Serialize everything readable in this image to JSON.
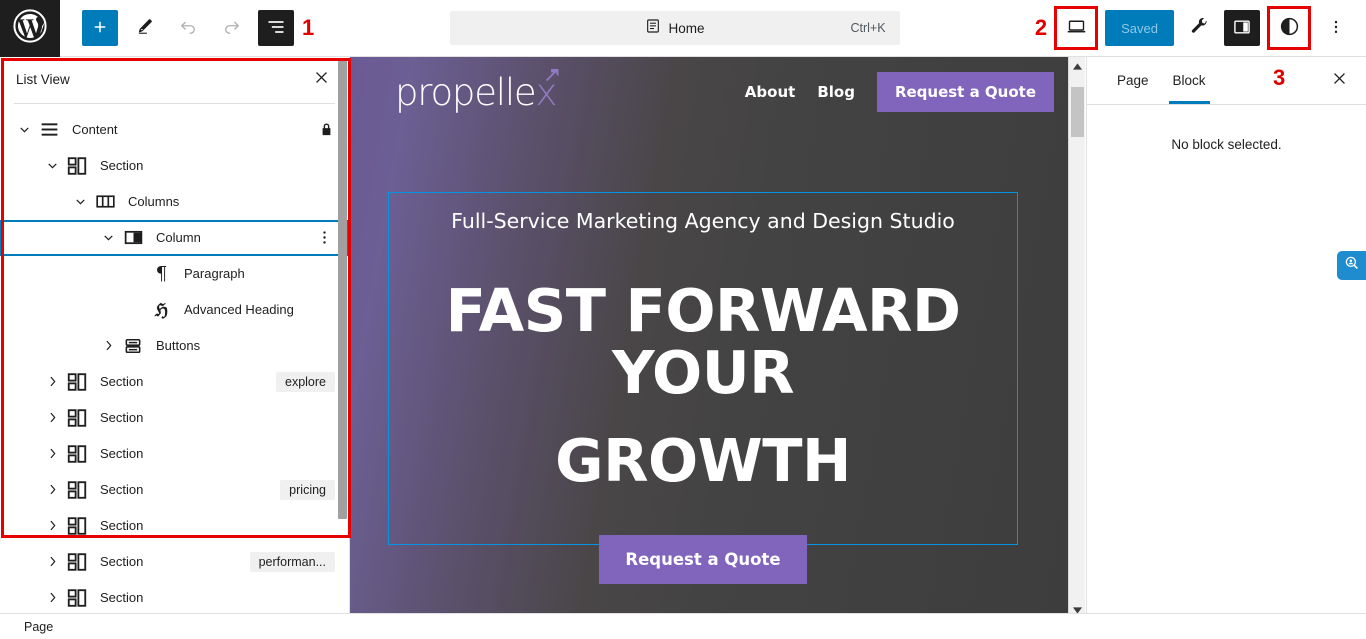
{
  "toolbar": {
    "wp_logo_icon": "wordpress-logo-icon",
    "add_block_label": "+",
    "add_block_icon": "plus-icon",
    "tools_icon": "pencil-icon",
    "undo_icon": "undo-arrow-icon",
    "redo_icon": "redo-arrow-icon",
    "list_view_icon": "list-view-icon",
    "marker_1": "1",
    "marker_2": "2",
    "marker_3": "3",
    "document": {
      "icon": "page-document-icon",
      "title": "Home",
      "shortcut": "Ctrl+K"
    },
    "view_device_icon": "laptop-view-icon",
    "save_label": "Saved",
    "tools_wrench_icon": "wrench-icon",
    "settings_sidebar_icon": "settings-sidebar-icon",
    "contrast_icon": "contrast-half-circle-icon",
    "options_icon": "three-dots-vertical-icon"
  },
  "list_view": {
    "title": "List View",
    "close_icon": "close-x-icon",
    "lock_icon": "lock-icon",
    "kebab_icon": "three-dots-vertical-icon",
    "rows": [
      {
        "label": "Content",
        "icon": "content-lines-icon",
        "depth": 0,
        "chevron": "down",
        "selected": false,
        "lock": true
      },
      {
        "label": "Section",
        "icon": "section-block-icon",
        "depth": 1,
        "chevron": "down",
        "selected": false
      },
      {
        "label": "Columns",
        "icon": "columns-icon",
        "depth": 2,
        "chevron": "down",
        "selected": false
      },
      {
        "label": "Column",
        "icon": "column-icon",
        "depth": 3,
        "chevron": "down",
        "selected": true,
        "kebab": true
      },
      {
        "label": "Paragraph",
        "icon": "paragraph-pilcrow-icon",
        "depth": 4,
        "chevron": "none",
        "selected": false
      },
      {
        "label": "Advanced Heading",
        "icon": "advanced-heading-icon",
        "depth": 4,
        "chevron": "none",
        "selected": false
      },
      {
        "label": "Buttons",
        "icon": "buttons-icon",
        "depth": 3,
        "chevron": "right",
        "selected": false
      },
      {
        "label": "Section",
        "icon": "section-block-icon",
        "depth": 1,
        "chevron": "right",
        "selected": false,
        "badge": "explore"
      },
      {
        "label": "Section",
        "icon": "section-block-icon",
        "depth": 1,
        "chevron": "right",
        "selected": false
      },
      {
        "label": "Section",
        "icon": "section-block-icon",
        "depth": 1,
        "chevron": "right",
        "selected": false
      },
      {
        "label": "Section",
        "icon": "section-block-icon",
        "depth": 1,
        "chevron": "right",
        "selected": false,
        "badge": "pricing"
      },
      {
        "label": "Section",
        "icon": "section-block-icon",
        "depth": 1,
        "chevron": "right",
        "selected": false
      },
      {
        "label": "Section",
        "icon": "section-block-icon",
        "depth": 1,
        "chevron": "right",
        "selected": false,
        "badge": "performan..."
      },
      {
        "label": "Section",
        "icon": "section-block-icon",
        "depth": 1,
        "chevron": "right",
        "selected": false
      }
    ],
    "footer_breadcrumb": "Page"
  },
  "canvas": {
    "site": {
      "logo_text": "propelle",
      "logo_accent": "x",
      "logo_arrow_icon": "arrow-up-right-icon",
      "nav_links": [
        "About",
        "Blog"
      ],
      "nav_cta": "Request a Quote"
    },
    "hero": {
      "subtitle": "Full-Service Marketing Agency and Design Studio",
      "heading_line1": "FAST FORWARD  YOUR",
      "heading_line2": "GROWTH",
      "button": "Request a Quote"
    },
    "scroll_up_icon": "scroll-up-arrow-icon",
    "scroll_down_icon": "scroll-down-arrow-icon"
  },
  "sidebar": {
    "tabs": [
      {
        "label": "Page",
        "active": false
      },
      {
        "label": "Block",
        "active": true
      }
    ],
    "close_icon": "close-x-icon",
    "empty_message": "No block selected."
  },
  "floating": {
    "search_icon": "search-magnifier-icon"
  },
  "colors": {
    "accent_blue": "#007cba",
    "annotation_red": "#e80000",
    "brand_purple": "#8165bd",
    "selection_blue": "#0693e3"
  }
}
